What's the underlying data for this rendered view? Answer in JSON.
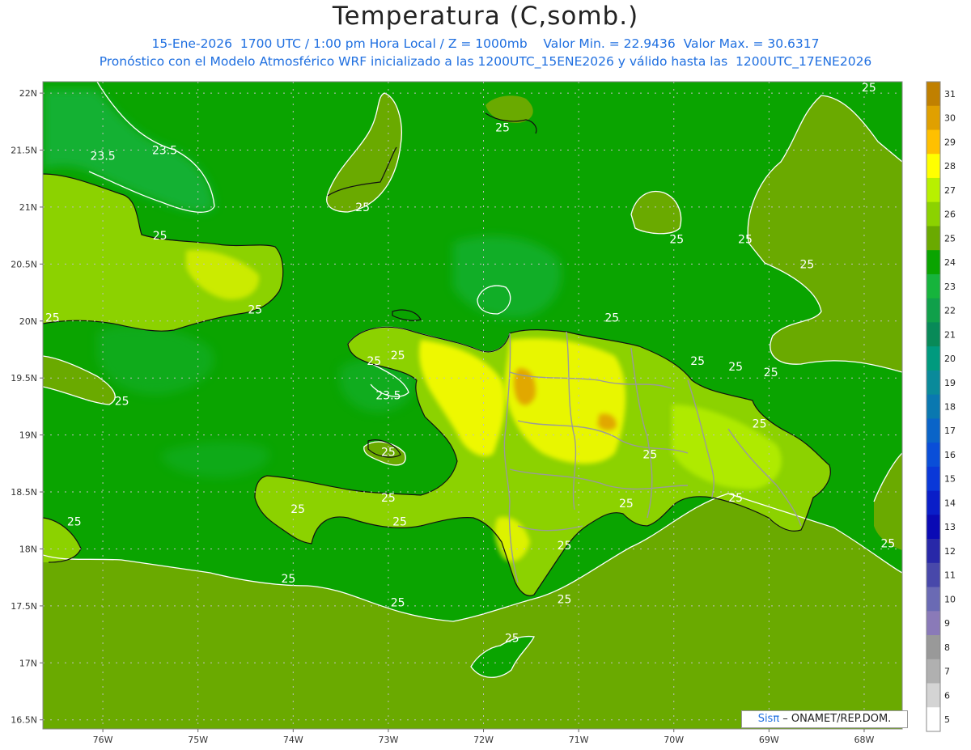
{
  "header": {
    "title": "Temperatura (C,somb.)",
    "line1": "15-Ene-2026  1700 UTC / 1:00 pm Hora Local / Z = 1000mb    Valor Min. = 22.9436  Valor Max. = 30.6317",
    "line2": "Pronóstico con el Modelo Atmosférico WRF inicializado a las 1200UTC_15ENE2026 y válido hasta las  1200UTC_17ENE2026"
  },
  "axes": {
    "lat_labels": [
      "22N",
      "21.5N",
      "21N",
      "20.5N",
      "20N",
      "19.5N",
      "19N",
      "18.5N",
      "18N",
      "17.5N",
      "17N",
      "16.5N"
    ],
    "lat_values": [
      22,
      21.5,
      21,
      20.5,
      20,
      19.5,
      19,
      18.5,
      18,
      17.5,
      17,
      16.5
    ],
    "lon_labels": [
      "76W",
      "75W",
      "74W",
      "73W",
      "72W",
      "71W",
      "70W",
      "69W",
      "68W"
    ],
    "lon_values": [
      -76,
      -75,
      -74,
      -73,
      -72,
      -71,
      -70,
      -69,
      -68
    ],
    "lat_range": [
      16.42,
      22.1
    ],
    "lon_range": [
      -76.63,
      -67.6
    ]
  },
  "colorbar": {
    "labels": [
      "31",
      "30",
      "29",
      "28",
      "27",
      "26",
      "25",
      "24",
      "23",
      "22",
      "21",
      "20",
      "19",
      "18",
      "17",
      "16",
      "15",
      "14",
      "13",
      "12",
      "11",
      "10",
      "9",
      "8",
      "7",
      "6",
      "5"
    ],
    "colors": [
      "#c08000",
      "#e0a000",
      "#ffc000",
      "#ffff00",
      "#b8f000",
      "#8cd200",
      "#6aaa00",
      "#0aa400",
      "#16b43c",
      "#10a04a",
      "#088a58",
      "#009a7e",
      "#0a8a9a",
      "#0a78b0",
      "#0a64c8",
      "#0a4ed8",
      "#0a38d8",
      "#0a1ec8",
      "#0a0ab4",
      "#2828a8",
      "#4848aa",
      "#6a6ab4",
      "#8a7ab8",
      "#999999",
      "#b0b0b0",
      "#d4d4d4",
      "#ffffff"
    ]
  },
  "map": {
    "ocean_color": "#0aa400",
    "land_color": "#6aaa00",
    "contour_labels": [
      {
        "text": "25",
        "lon": -67.95,
        "lat": 22.05
      },
      {
        "text": "25",
        "lon": -71.8,
        "lat": 21.7
      },
      {
        "text": "23.5",
        "lon": -76.0,
        "lat": 21.45
      },
      {
        "text": "23.5",
        "lon": -75.35,
        "lat": 21.5
      },
      {
        "text": "25",
        "lon": -75.4,
        "lat": 20.75
      },
      {
        "text": "25",
        "lon": -73.27,
        "lat": 21.0
      },
      {
        "text": "25",
        "lon": -69.97,
        "lat": 20.72
      },
      {
        "text": "25",
        "lon": -69.25,
        "lat": 20.72
      },
      {
        "text": "25",
        "lon": -68.6,
        "lat": 20.5
      },
      {
        "text": "25",
        "lon": -74.4,
        "lat": 20.1
      },
      {
        "text": "25",
        "lon": -76.53,
        "lat": 20.03
      },
      {
        "text": "25",
        "lon": -70.65,
        "lat": 20.03
      },
      {
        "text": "25",
        "lon": -72.9,
        "lat": 19.7
      },
      {
        "text": "25",
        "lon": -73.15,
        "lat": 19.65
      },
      {
        "text": "25",
        "lon": -69.75,
        "lat": 19.65
      },
      {
        "text": "25",
        "lon": -69.35,
        "lat": 19.6
      },
      {
        "text": "25",
        "lon": -68.98,
        "lat": 19.55
      },
      {
        "text": "23.5",
        "lon": -73.0,
        "lat": 19.35
      },
      {
        "text": "25",
        "lon": -75.8,
        "lat": 19.3
      },
      {
        "text": "25",
        "lon": -69.1,
        "lat": 19.1
      },
      {
        "text": "25",
        "lon": -73.0,
        "lat": 18.85
      },
      {
        "text": "25",
        "lon": -70.25,
        "lat": 18.83
      },
      {
        "text": "25",
        "lon": -73.0,
        "lat": 18.45
      },
      {
        "text": "25",
        "lon": -73.95,
        "lat": 18.35
      },
      {
        "text": "25",
        "lon": -69.35,
        "lat": 18.45
      },
      {
        "text": "25",
        "lon": -70.5,
        "lat": 18.4
      },
      {
        "text": "25",
        "lon": -72.88,
        "lat": 18.24
      },
      {
        "text": "25",
        "lon": -76.3,
        "lat": 18.24
      },
      {
        "text": "25",
        "lon": -71.15,
        "lat": 18.03
      },
      {
        "text": "25",
        "lon": -67.75,
        "lat": 18.05
      },
      {
        "text": "25",
        "lon": -74.05,
        "lat": 17.74
      },
      {
        "text": "25",
        "lon": -72.9,
        "lat": 17.53
      },
      {
        "text": "25",
        "lon": -71.15,
        "lat": 17.56
      },
      {
        "text": "25",
        "lon": -71.7,
        "lat": 17.22
      }
    ]
  },
  "credit": {
    "prefix": "Sisπ",
    "suffix": " – ONAMET/REP.DOM."
  }
}
